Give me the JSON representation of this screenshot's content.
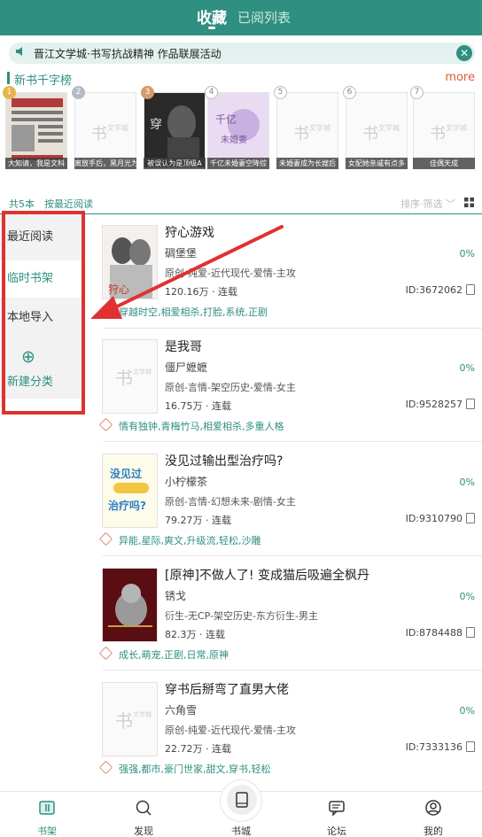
{
  "header": {
    "tab_active": "收藏",
    "tab_inactive": "已阅列表"
  },
  "notice": {
    "icon": "speaker-icon",
    "text": "晋江文学城·书写抗战精神 作品联展活动",
    "close_icon": "close-icon"
  },
  "ranking": {
    "title": "新书千字榜",
    "more": "more",
    "items": [
      {
        "rank": "1",
        "caption": "大知请，我是文科"
      },
      {
        "rank": "2",
        "caption": "离放手后，黑月光为"
      },
      {
        "rank": "3",
        "caption": "被误认为是顶级A"
      },
      {
        "rank": "4",
        "caption": "千亿未婚妻空降综"
      },
      {
        "rank": "5",
        "caption": "未婚妻成为长嫂后"
      },
      {
        "rank": "6",
        "caption": "女配她亲戚有点多"
      },
      {
        "rank": "7",
        "caption": "佳偶天成"
      }
    ]
  },
  "filter": {
    "count": "共5本",
    "sort": "按最近阅读",
    "sort_filter": "排序·筛选"
  },
  "sidebar": {
    "items": [
      "最近阅读",
      "临时书架",
      "本地导入"
    ],
    "add_label": "新建分类"
  },
  "books": [
    {
      "title": "狩心游戏",
      "author": "碉堡堡",
      "progress": "0%",
      "category": "原创-纯爱-近代现代-爱情-主攻",
      "words": "120.16万 · 连载",
      "id": "ID:3672062",
      "tags": "穿越时空,相爱相杀,打脸,系统,正剧"
    },
    {
      "title": "是我哥",
      "author": "僵尸嬷嬷",
      "progress": "0%",
      "category": "原创-言情-架空历史-爱情-女主",
      "words": "16.75万 · 连载",
      "id": "ID:9528257",
      "tags": "情有独钟,青梅竹马,相爱相杀,多重人格"
    },
    {
      "title": "没见过输出型治疗吗?",
      "author": "小柠檬茶",
      "progress": "0%",
      "category": "原创-言情-幻想未来-剧情-女主",
      "words": "79.27万 · 连载",
      "id": "ID:9310790",
      "tags": "异能,星际,爽文,升级流,轻松,沙雕"
    },
    {
      "title": "[原神]不做人了! 变成猫后吸遍全枫丹",
      "author": "锈戈",
      "progress": "0%",
      "category": "衍生-无CP-架空历史-东方衍生-男主",
      "words": "82.3万 · 连载",
      "id": "ID:8784488",
      "tags": "成长,萌宠,正剧,日常,原神"
    },
    {
      "title": "穿书后掰弯了直男大佬",
      "author": "六角雪",
      "progress": "0%",
      "category": "原创-纯爱-近代现代-爱情-主攻",
      "words": "22.72万 · 连载",
      "id": "ID:7333136",
      "tags": "强强,都市,豪门世家,甜文,穿书,轻松"
    }
  ],
  "bottom_nav": {
    "items": [
      "书架",
      "发现",
      "书城",
      "论坛",
      "我的"
    ]
  },
  "colors": {
    "accent": "#2f8f80",
    "annotation": "#e03131",
    "more": "#e05a3a"
  }
}
